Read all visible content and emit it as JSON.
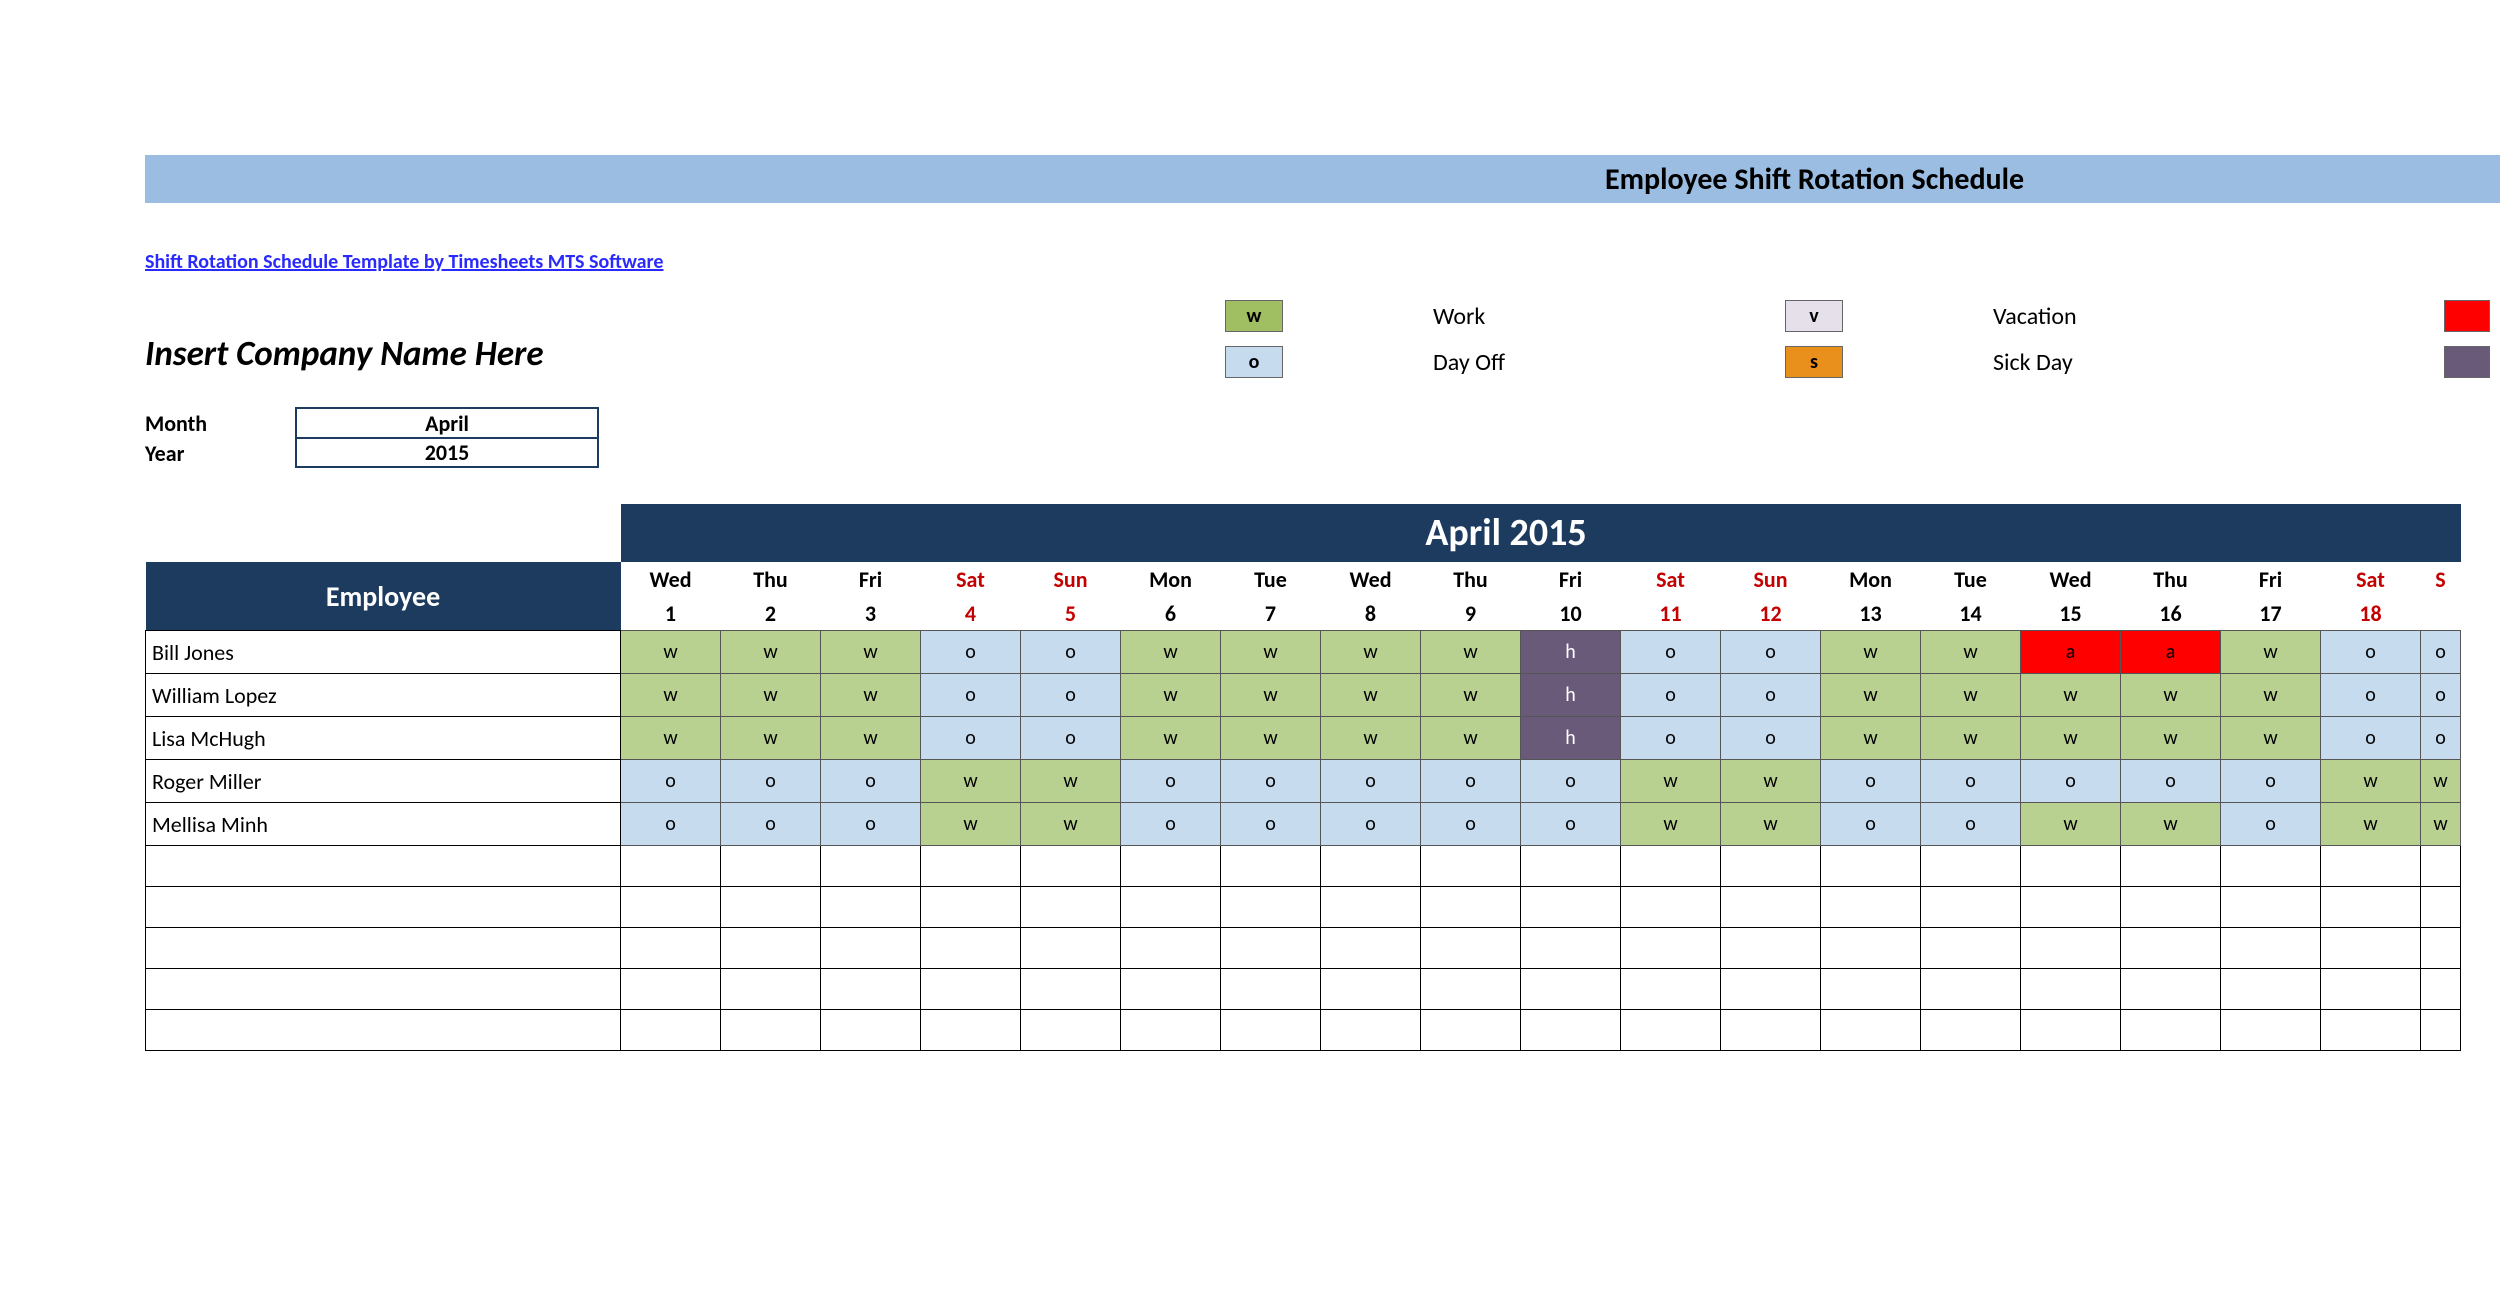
{
  "header": {
    "title": "Employee Shift Rotation Schedule"
  },
  "template_link": "Shift Rotation Schedule Template by Timesheets MTS Software",
  "company_name_placeholder": "Insert Company Name Here",
  "meta": {
    "month_label": "Month",
    "month_value": "April",
    "year_label": "Year",
    "year_value": "2015"
  },
  "legend": [
    {
      "code": "w",
      "label": "Work",
      "cls": "sw-w"
    },
    {
      "code": "o",
      "label": "Day Off",
      "cls": "sw-o"
    },
    {
      "code": "v",
      "label": "Vacation",
      "cls": "sw-v"
    },
    {
      "code": "s",
      "label": "Sick Day",
      "cls": "sw-s"
    }
  ],
  "legend_right_swatches": [
    {
      "cls": "sw-a"
    },
    {
      "cls": "sw-h"
    }
  ],
  "month_title": "April 2015",
  "columns": [
    {
      "dow": "Wed",
      "date": "1",
      "weekend": false
    },
    {
      "dow": "Thu",
      "date": "2",
      "weekend": false
    },
    {
      "dow": "Fri",
      "date": "3",
      "weekend": false
    },
    {
      "dow": "Sat",
      "date": "4",
      "weekend": true
    },
    {
      "dow": "Sun",
      "date": "5",
      "weekend": true
    },
    {
      "dow": "Mon",
      "date": "6",
      "weekend": false
    },
    {
      "dow": "Tue",
      "date": "7",
      "weekend": false
    },
    {
      "dow": "Wed",
      "date": "8",
      "weekend": false
    },
    {
      "dow": "Thu",
      "date": "9",
      "weekend": false
    },
    {
      "dow": "Fri",
      "date": "10",
      "weekend": false
    },
    {
      "dow": "Sat",
      "date": "11",
      "weekend": true
    },
    {
      "dow": "Sun",
      "date": "12",
      "weekend": true
    },
    {
      "dow": "Mon",
      "date": "13",
      "weekend": false
    },
    {
      "dow": "Tue",
      "date": "14",
      "weekend": false
    },
    {
      "dow": "Wed",
      "date": "15",
      "weekend": false
    },
    {
      "dow": "Thu",
      "date": "16",
      "weekend": false
    },
    {
      "dow": "Fri",
      "date": "17",
      "weekend": false
    },
    {
      "dow": "Sat",
      "date": "18",
      "weekend": true
    },
    {
      "dow": "S",
      "date": "",
      "weekend": true
    }
  ],
  "employee_header": "Employee",
  "employees": [
    {
      "name": "Bill Jones",
      "shifts": [
        "w",
        "w",
        "w",
        "o",
        "o",
        "w",
        "w",
        "w",
        "w",
        "h",
        "o",
        "o",
        "w",
        "w",
        "a",
        "a",
        "w",
        "o",
        "o"
      ]
    },
    {
      "name": "William Lopez",
      "shifts": [
        "w",
        "w",
        "w",
        "o",
        "o",
        "w",
        "w",
        "w",
        "w",
        "h",
        "o",
        "o",
        "w",
        "w",
        "w",
        "w",
        "w",
        "o",
        "o"
      ]
    },
    {
      "name": "Lisa McHugh",
      "shifts": [
        "w",
        "w",
        "w",
        "o",
        "o",
        "w",
        "w",
        "w",
        "w",
        "h",
        "o",
        "o",
        "w",
        "w",
        "w",
        "w",
        "w",
        "o",
        "o"
      ]
    },
    {
      "name": "Roger Miller",
      "shifts": [
        "o",
        "o",
        "o",
        "w",
        "w",
        "o",
        "o",
        "o",
        "o",
        "o",
        "w",
        "w",
        "o",
        "o",
        "o",
        "o",
        "o",
        "w",
        "w"
      ]
    },
    {
      "name": "Mellisa Minh",
      "shifts": [
        "o",
        "o",
        "o",
        "w",
        "w",
        "o",
        "o",
        "o",
        "o",
        "o",
        "w",
        "w",
        "o",
        "o",
        "w",
        "w",
        "o",
        "w",
        "w"
      ]
    }
  ],
  "empty_rows": 5,
  "shift_classes": {
    "w": "cw",
    "o": "co",
    "h": "ch",
    "a": "ca",
    "v": "cv",
    "s": "cs"
  }
}
